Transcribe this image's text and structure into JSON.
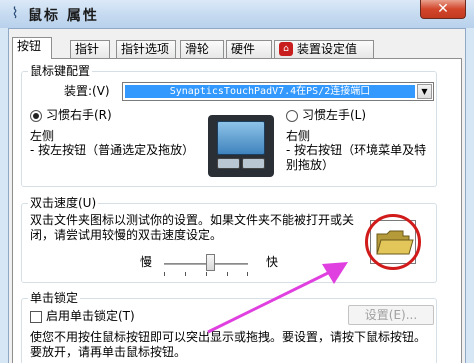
{
  "window": {
    "title": "鼠标 属性",
    "close_glyph": "✕"
  },
  "tabs": [
    {
      "label": "按钮",
      "active": true
    },
    {
      "label": "指针"
    },
    {
      "label": "指针选项"
    },
    {
      "label": "滑轮"
    },
    {
      "label": "硬件"
    },
    {
      "label": "装置设定值"
    }
  ],
  "button_config": {
    "group_title": "鼠标键配置",
    "device_label": "装置:(V)",
    "device_value": "SynapticsTouchPadV7.4在PS/2连接端口",
    "right_hand_label": "习惯右手(R)",
    "left_hand_label": "习惯左手(L)",
    "left_side_title": "左侧",
    "left_side_desc": "- 按左按钮（普通选定及拖放）",
    "right_side_title": "右侧",
    "right_side_desc": "- 按右按钮（环境菜单及特别拖放）"
  },
  "double_click": {
    "group_title": "双击速度(U)",
    "desc": "双击文件夹图标以测试你的设置。如果文件夹不能被打开或关闭，请尝试用较慢的双击速度设定。",
    "slow_label": "慢",
    "fast_label": "快",
    "speed_level": 0.55
  },
  "click_lock": {
    "group_title": "单击锁定",
    "enable_label": "启用单击锁定(T)",
    "settings_button": "设置(E)...",
    "desc": "使您不用按住鼠标按钮即可以突出显示或拖拽。要设置，请按下鼠标按钮。要放开，请再单击鼠标按钮。"
  },
  "annotation": {
    "circle_color": "#d11a1a",
    "arrow_color": "#e040e0"
  },
  "icons": {
    "title_icon": "mouse-icon",
    "tab5_icon": "synaptics-icon",
    "folder": "folder-icon"
  }
}
